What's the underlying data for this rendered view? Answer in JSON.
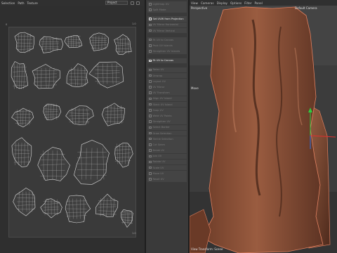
{
  "uv_editor": {
    "menu": [
      "Selection",
      "Path",
      "Texture"
    ],
    "project_select": "Project",
    "canvas_labels": {
      "top_left": "0",
      "top_right": "1.0",
      "bottom_right": "1.0"
    }
  },
  "tools": [
    {
      "label": "Lightmap UV",
      "active": false
    },
    {
      "label": "Split Mode",
      "active": false
    },
    {
      "label": "Set UVW from Projection",
      "active": true
    },
    {
      "label": "UV Mirror Horizontal",
      "active": false
    },
    {
      "label": "UV Mirror Vertical",
      "active": false
    },
    {
      "label": "Fit UV to Canvas",
      "active": false
    },
    {
      "label": "Pack UV Islands",
      "active": false
    },
    {
      "label": "Straighten UV Islands",
      "active": false
    },
    {
      "label": "Fit UV to Canvas",
      "active": true
    },
    {
      "label": "Relax UV",
      "active": false
    },
    {
      "label": "Unwrap",
      "active": false
    },
    {
      "label": "Layout UV",
      "active": false
    },
    {
      "label": "UV Mirror",
      "active": false
    },
    {
      "label": "UV Transform",
      "active": false
    },
    {
      "label": "Align UV Island",
      "active": false
    },
    {
      "label": "Stack UV Island",
      "active": false
    },
    {
      "label": "Snap UV",
      "active": false
    },
    {
      "label": "Weld UV Points",
      "active": false
    },
    {
      "label": "Straighten UV",
      "active": false
    },
    {
      "label": "Select Border",
      "active": false
    },
    {
      "label": "Grow Selection",
      "active": false
    },
    {
      "label": "Shrink Selection",
      "active": false
    },
    {
      "label": "Cut Seam",
      "active": false
    },
    {
      "label": "Break UV",
      "active": false
    },
    {
      "label": "Join UV",
      "active": false
    },
    {
      "label": "Rotate UV",
      "active": false
    },
    {
      "label": "Scale UV",
      "active": false
    },
    {
      "label": "Move UV",
      "active": false
    },
    {
      "label": "Reset UV",
      "active": false
    }
  ],
  "viewport": {
    "menu": [
      "View",
      "Cameras",
      "Display",
      "Options",
      "Filter",
      "Panel"
    ],
    "view_name": "Perspective",
    "camera": "Default Camera",
    "move_label": "Move",
    "status": "View Transform: Scene"
  },
  "colors": {
    "rock_fill": "#8a4f36",
    "rock_dark": "#5a3222",
    "selection_outline": "#e08060",
    "uv_wire": "#dcdcdc",
    "uv_background": "#3a3a3a"
  },
  "icons": [
    "grid-icon",
    "tool-icon",
    "axis-gizmo-icon"
  ]
}
